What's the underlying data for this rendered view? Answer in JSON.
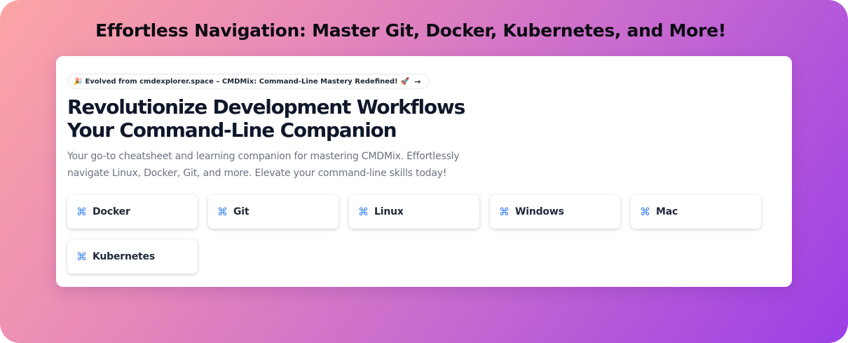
{
  "banner": {
    "title": "Effortless Navigation: Master Git, Docker, Kubernetes, and More!"
  },
  "hero": {
    "announcement": {
      "emoji": "🎉",
      "text": "Evolved from cmdexplorer.space – CMDMix: Command-Line Mastery Redefined!",
      "rocket": "🚀",
      "arrow": "→"
    },
    "headline_line1": "Revolutionize Development Workflows",
    "headline_line2": "Your Command-Line Companion",
    "subtitle": "Your go-to cheatsheet and learning companion for mastering CMDMix. Effortlessly navigate Linux, Docker, Git, and more. Elevate your command-line skills today!"
  },
  "categories": [
    {
      "icon": "⌘",
      "label": "Docker"
    },
    {
      "icon": "⌘",
      "label": "Git"
    },
    {
      "icon": "⌘",
      "label": "Linux"
    },
    {
      "icon": "⌘",
      "label": "Windows"
    },
    {
      "icon": "⌘",
      "label": "Mac"
    },
    {
      "icon": "⌘",
      "label": "Kubernetes"
    }
  ],
  "colors": {
    "accent": "#3b82f6",
    "gradient_start": "#fca5a5",
    "gradient_end": "#9b3fe6"
  }
}
